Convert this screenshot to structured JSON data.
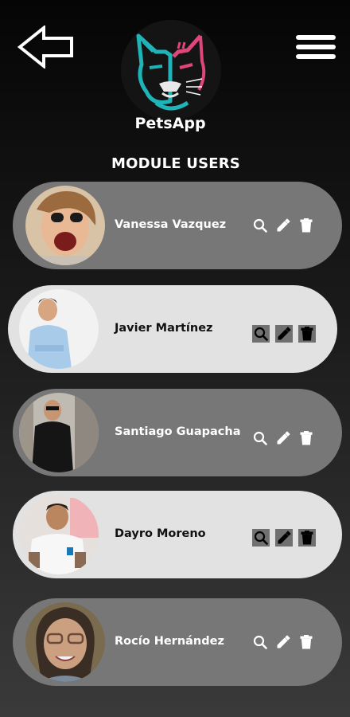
{
  "header": {
    "app_name": "PetsApp",
    "back_icon": "back-arrow-icon",
    "menu_icon": "hamburger-menu-icon",
    "logo": "bulldog-logo"
  },
  "module": {
    "title": "MODULE USERS"
  },
  "colors": {
    "card_dark": "#777777",
    "card_light": "#e2e2e2",
    "logo_teal": "#1fb5b8",
    "logo_pink": "#e0457b"
  },
  "users": [
    {
      "name": "Vanessa Vazquez",
      "style": "dark",
      "actions": [
        "search-icon",
        "edit-icon",
        "delete-icon"
      ]
    },
    {
      "name": "Javier Martínez",
      "style": "light",
      "actions": [
        "search-icon",
        "edit-icon",
        "delete-icon"
      ]
    },
    {
      "name": "Santiago Guapacha",
      "style": "dark",
      "actions": [
        "search-icon",
        "edit-icon",
        "delete-icon"
      ]
    },
    {
      "name": "Dayro Moreno",
      "style": "light",
      "actions": [
        "search-icon",
        "edit-icon",
        "delete-icon"
      ]
    },
    {
      "name": "Rocío Hernández",
      "style": "dark",
      "actions": [
        "search-icon",
        "edit-icon",
        "delete-icon"
      ]
    }
  ]
}
